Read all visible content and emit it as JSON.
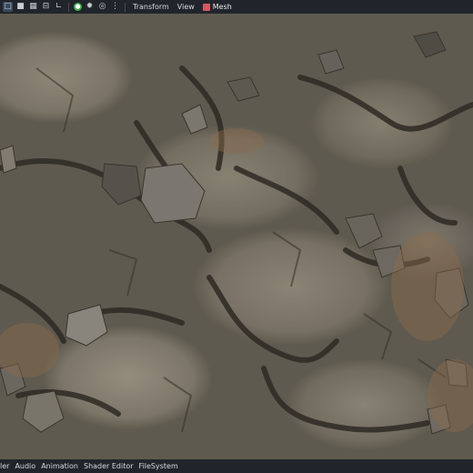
{
  "toolbar": {
    "icons": [
      "select-icon",
      "lock-icon",
      "group-icon",
      "grid-snap-icon",
      "ruler-icon",
      "script-icon",
      "pivot-icon",
      "origin-icon",
      "more-icon"
    ],
    "menus": [
      "Transform",
      "View"
    ],
    "context_button": "Mesh"
  },
  "bottom_panel": {
    "tabs": [
      "ler",
      "Audio",
      "Animation",
      "Shader Editor",
      "FileSystem"
    ]
  },
  "viewport": {
    "content": "rocky-ground-render"
  }
}
